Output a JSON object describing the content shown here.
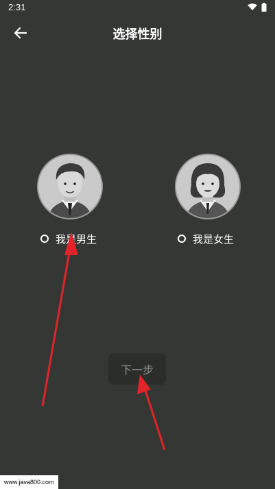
{
  "status_bar": {
    "time": "2:31"
  },
  "header": {
    "title": "选择性别"
  },
  "options": {
    "male_label": "我是男生",
    "female_label": "我是女生"
  },
  "next_button": {
    "label": "下一步"
  },
  "watermark": "www.java800.com",
  "colors": {
    "background": "#353734",
    "button_bg": "#2b2d2b",
    "button_text": "#8f918f",
    "annotation_arrow": "#e0242a"
  }
}
